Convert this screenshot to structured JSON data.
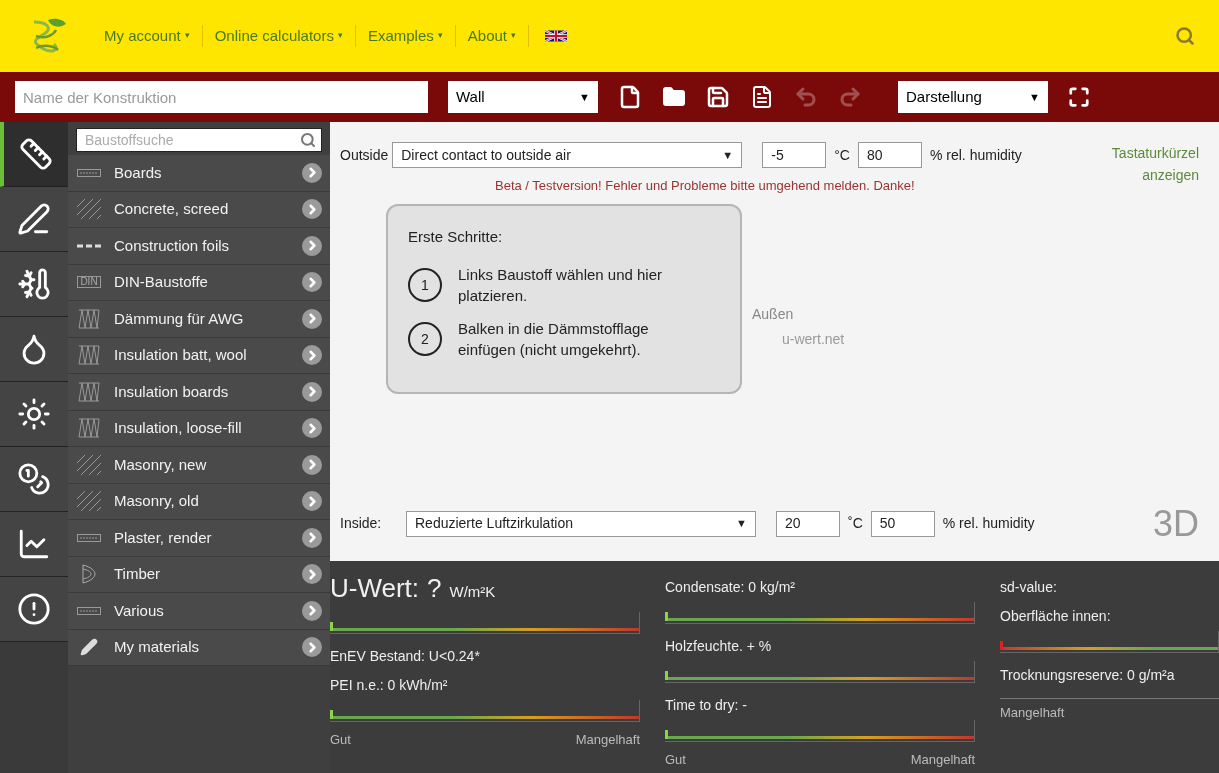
{
  "nav": {
    "items": [
      {
        "label": "My account",
        "caret": "▾"
      },
      {
        "label": "Online calculators",
        "caret": "▾"
      },
      {
        "label": "Examples",
        "caret": "▾"
      },
      {
        "label": "About",
        "caret": "▾"
      }
    ]
  },
  "toolbar": {
    "name_placeholder": "Name der Konstruktion",
    "construction_type": "Wall",
    "construction_type_caret": "▼",
    "view": "Darstellung",
    "view_caret": "▼"
  },
  "sidebar_tabs": [
    {
      "kind": "geometry",
      "selected": true
    },
    {
      "kind": "edit",
      "selected": false
    },
    {
      "kind": "climate",
      "selected": false
    },
    {
      "kind": "moisture",
      "selected": false
    },
    {
      "kind": "heat",
      "selected": false
    },
    {
      "kind": "cost",
      "selected": false
    },
    {
      "kind": "chart",
      "selected": false
    },
    {
      "kind": "warning",
      "selected": false
    }
  ],
  "materials": {
    "search_placeholder": "Baustoffsuche",
    "items": [
      {
        "label": "Boards",
        "kind": "board"
      },
      {
        "label": "Concrete, screed",
        "kind": "hatch"
      },
      {
        "label": "Construction foils",
        "kind": "foil"
      },
      {
        "label": "DIN-Baustoffe",
        "kind": "din",
        "icon_label": "DIN"
      },
      {
        "label": "Dämmung für AWG",
        "kind": "insulation"
      },
      {
        "label": "Insulation batt, wool",
        "kind": "insulation"
      },
      {
        "label": "Insulation boards",
        "kind": "insulation"
      },
      {
        "label": "Insulation, loose-fill",
        "kind": "insulation"
      },
      {
        "label": "Masonry, new",
        "kind": "hatch"
      },
      {
        "label": "Masonry, old",
        "kind": "hatch"
      },
      {
        "label": "Plaster, render",
        "kind": "board"
      },
      {
        "label": "Timber",
        "kind": "timber"
      },
      {
        "label": "Various",
        "kind": "board"
      },
      {
        "label": "My materials",
        "kind": "pencil"
      }
    ]
  },
  "outside": {
    "label": "Outside",
    "condition": "Direct contact to outside air",
    "caret": "▼",
    "temperature": "-5",
    "temperature_unit": "°C",
    "humidity": "80",
    "humidity_label": "% rel. humidity"
  },
  "shortcuts_link": "Tastaturkürzel anzeigen",
  "beta_notice": "Beta / Testversion! Fehler und Probleme bitte umgehend melden. Danke!",
  "first_steps": {
    "title": "Erste Schritte:",
    "steps": [
      {
        "number": "1",
        "text": "Links Baustoff wählen und hier platzieren."
      },
      {
        "number": "2",
        "text": "Balken in die Dämmstofflage einfügen (nicht umgekehrt)."
      }
    ]
  },
  "canvas": {
    "outside_label": "Außen",
    "watermark": "u-wert.net"
  },
  "inside": {
    "label": "Inside:",
    "condition": "Reduzierte Luftzirkulation",
    "caret": "▼",
    "temperature": "20",
    "temperature_unit": "˚C",
    "humidity": "50",
    "humidity_label": "% rel. humidity"
  },
  "view_3d": "3D",
  "results": {
    "u_value": {
      "label": "U-Wert:",
      "value": "?",
      "unit": "W/m²K"
    },
    "columns": [
      [
        {
          "kind": "gauge",
          "level": 0
        },
        {
          "kind": "text",
          "text": "EnEV Bestand: U<0.24*"
        },
        {
          "kind": "text",
          "text": "PEI n.e.: 0 kWh/m²"
        },
        {
          "kind": "gauge",
          "level": 0
        },
        {
          "kind": "legend",
          "left": "Gut",
          "right": "Mangelhaft"
        }
      ],
      [
        {
          "kind": "text",
          "text": "Condensate: 0 kg/m²"
        },
        {
          "kind": "gauge",
          "level": 0
        },
        {
          "kind": "text",
          "text": "Holzfeuchte. + %"
        },
        {
          "kind": "gauge",
          "level": 0
        },
        {
          "kind": "text",
          "text": "Time to dry: -"
        },
        {
          "kind": "gauge",
          "level": 0
        },
        {
          "kind": "legend",
          "left": "Gut",
          "right": "Mangelhaft"
        }
      ],
      [
        {
          "kind": "text",
          "text": "sd-value:"
        },
        {
          "kind": "text",
          "text": "Oberfläche innen:"
        },
        {
          "kind": "gauge_reversed",
          "level": 0
        },
        {
          "kind": "text",
          "text": "Trocknungsreserve: 0 g/m²a"
        },
        {
          "kind": "rule"
        },
        {
          "kind": "legend",
          "left": "Mangelhaft"
        }
      ]
    ]
  }
}
